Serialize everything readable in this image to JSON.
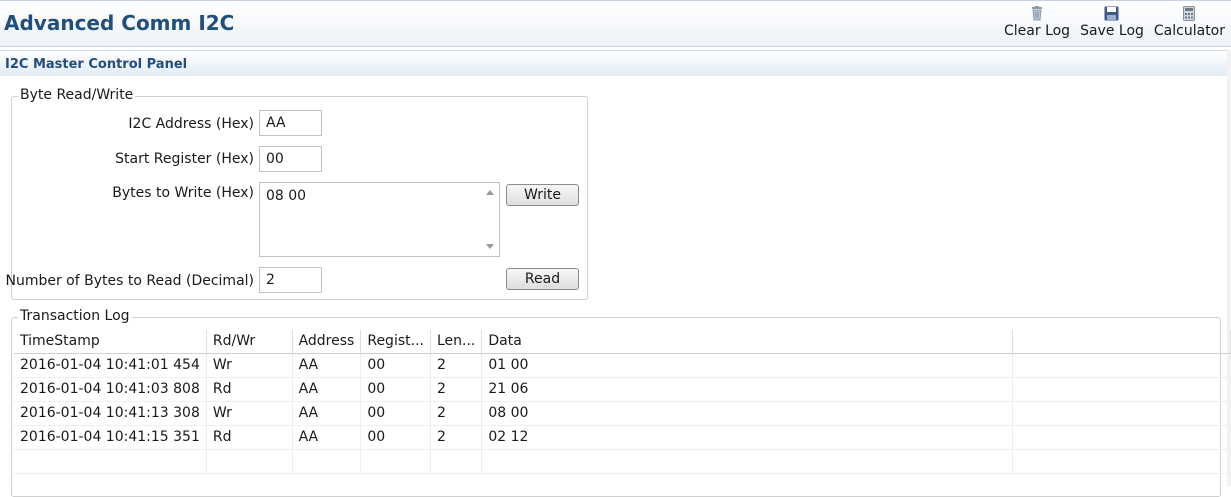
{
  "app": {
    "title": "Advanced Comm I2C"
  },
  "toolbar": {
    "clear_log": {
      "label": "Clear Log",
      "icon": "trash-icon"
    },
    "save_log": {
      "label": "Save Log",
      "icon": "floppy-disk-icon"
    },
    "calculator": {
      "label": "Calculator",
      "icon": "calculator-icon"
    }
  },
  "panel": {
    "title": "I2C Master Control Panel"
  },
  "byte_rw": {
    "legend": "Byte Read/Write",
    "i2c_address": {
      "label": "I2C Address (Hex)",
      "value": "AA"
    },
    "start_register": {
      "label": "Start Register (Hex)",
      "value": "00"
    },
    "bytes_to_write": {
      "label": "Bytes to Write (Hex)",
      "value": "08 00"
    },
    "bytes_to_read": {
      "label": "Number of Bytes to Read (Decimal)",
      "value": "2"
    },
    "write_label": "Write",
    "read_label": "Read"
  },
  "transaction_log": {
    "legend": "Transaction Log",
    "columns": [
      "TimeStamp",
      "Rd/Wr",
      "Address",
      "Regist...",
      "Len...",
      "Data"
    ],
    "rows": [
      [
        "2016-01-04 10:41:01 454",
        "Wr",
        "AA",
        "00",
        "2",
        "01 00"
      ],
      [
        "2016-01-04 10:41:03 808",
        "Rd",
        "AA",
        "00",
        "2",
        "21 06"
      ],
      [
        "2016-01-04 10:41:13 308",
        "Wr",
        "AA",
        "00",
        "2",
        "08 00"
      ],
      [
        "2016-01-04 10:41:15 351",
        "Rd",
        "AA",
        "00",
        "2",
        "02 12"
      ]
    ]
  },
  "colors": {
    "title": "#1f4f7f",
    "border": "#cfcfcf"
  }
}
